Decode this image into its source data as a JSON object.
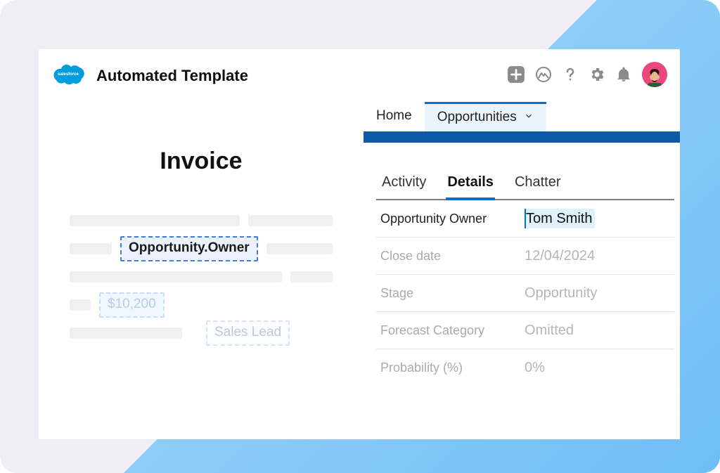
{
  "app_title": "Automated Template",
  "logo_text": "salesforce",
  "nav": {
    "items": [
      {
        "label": "Home"
      },
      {
        "label": "Opportunities",
        "active": true
      }
    ]
  },
  "invoice": {
    "title": "Invoice",
    "owner_token": "Opportunity.Owner",
    "amount_token": "$10,200",
    "lead_token": "Sales Lead"
  },
  "detail_tabs": [
    {
      "label": "Activity"
    },
    {
      "label": "Details",
      "active": true
    },
    {
      "label": "Chatter"
    }
  ],
  "fields": [
    {
      "label": "Opportunity Owner",
      "value": "Tom Smith"
    },
    {
      "label": "Close date",
      "value": "12/04/2024"
    },
    {
      "label": "Stage",
      "value": "Opportunity"
    },
    {
      "label": "Forecast Category",
      "value": "Omitted"
    },
    {
      "label": "Probability (%)",
      "value": "0%"
    }
  ]
}
